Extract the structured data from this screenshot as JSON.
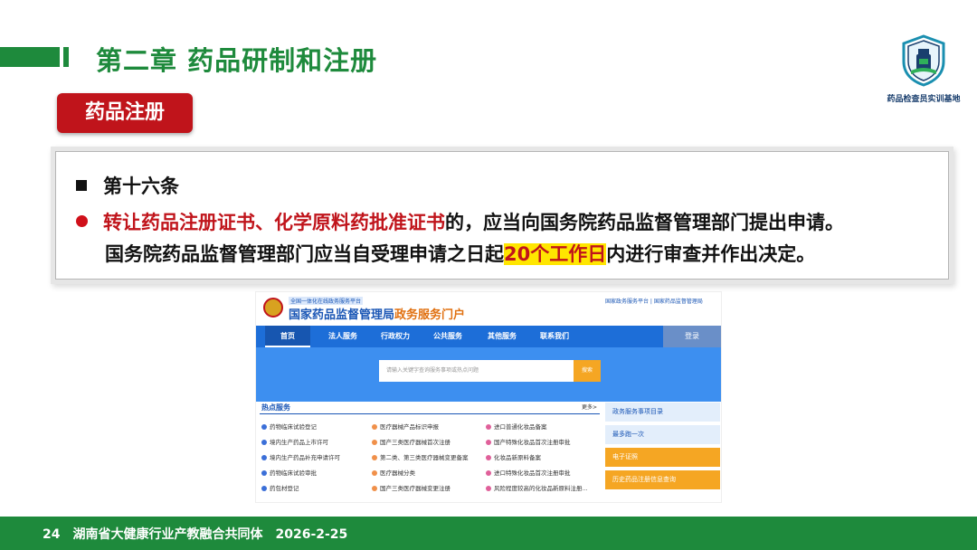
{
  "header": {
    "chapter_title": "第二章  药品研制和注册",
    "logo_text": "药品检查员实训基地"
  },
  "section_tag": "药品注册",
  "article": {
    "title": "第十六条",
    "line1_red": "转让药品注册证书、化学原料药批准证书",
    "line1_rest": "的，应当向国务院药品监督管理部门提出申请。",
    "line2_pre": "国务院药品监督管理部门应当自受理申请之日起",
    "line2_highlight": "20个工作日",
    "line2_post": "内进行审查并作出决定。"
  },
  "screenshot": {
    "subtitle": "全国一体化在线政务服务平台",
    "site_title": "国家药品监督管理局",
    "site_title_suffix": "政务服务门户",
    "top_links": "国家政务服务平台  |  国家药品监督管理局",
    "nav": [
      "首页",
      "法人服务",
      "行政权力",
      "公共服务",
      "其他服务",
      "联系我们"
    ],
    "login": "登录",
    "search_placeholder": "请输入关键字查询服务事项或热点问题",
    "search_button": "搜索",
    "hot_title": "热点服务",
    "more": "更多>",
    "col1": [
      "药物临床试验登记",
      "境内生产药品上市许可",
      "境内生产药品补充申请许可",
      "药物临床试验审批",
      "药包材登记"
    ],
    "col2": [
      "医疗器械产品标识申报",
      "国产三类医疗器械首次注册",
      "第二类、第三类医疗器械变更备案",
      "医疗器械分类",
      "国产三类医疗器械变更注册"
    ],
    "col3": [
      "进口普通化妆品备案",
      "国产特殊化妆品首次注册审批",
      "化妆品新原料备案",
      "进口特殊化妆品首次注册审批",
      "风险程度较高的化妆品新原料注册..."
    ],
    "side": [
      "政务服务事项目录",
      "最多跑一次",
      "电子证照",
      "历史药品注册信息查询"
    ]
  },
  "footer": {
    "page": "24",
    "org": "湖南省大健康行业产教融合共同体",
    "date": "2026-2-25"
  }
}
